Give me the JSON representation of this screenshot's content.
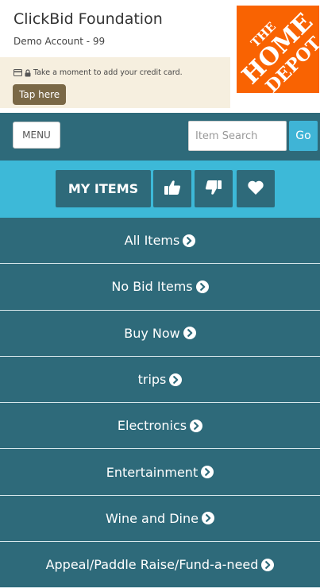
{
  "header": {
    "org_name": "ClickBid Foundation",
    "account": "Demo Account - 99",
    "notice_text": "Take a moment to add your credit card.",
    "tap_label": "Tap here",
    "logo_text": "THE HOME DEPOT"
  },
  "toolbar": {
    "menu_label": "MENU",
    "search_placeholder": "Item Search",
    "go_label": "Go"
  },
  "filters": {
    "my_items_label": "MY ITEMS",
    "icons": [
      "thumbs-up-icon",
      "thumbs-down-icon",
      "heart-icon"
    ]
  },
  "categories": [
    "All Items",
    "No Bid Items",
    "Buy Now",
    "trips",
    "Electronics",
    "Entertainment",
    "Wine and Dine",
    "Appeal/Paddle Raise/Fund-a-need"
  ],
  "colors": {
    "primary": "#2e6a7a",
    "accent": "#3db9d8",
    "go_button": "#3fb4d6",
    "notice_bg": "#f6efdf",
    "tap_button": "#7a6846",
    "logo": "#f96302"
  }
}
